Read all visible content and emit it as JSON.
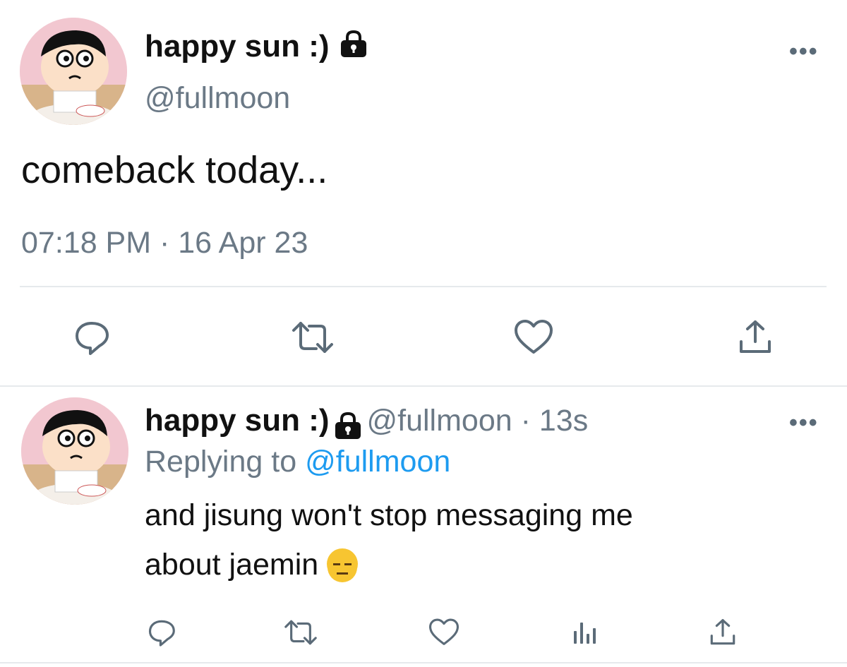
{
  "main_tweet": {
    "display_name": "happy sun :)",
    "handle": "@fullmoon",
    "text": "comeback today...",
    "timestamp": "07:18 PM · 16 Apr 23",
    "more_label": "•••",
    "avatar_icon": "cartoon-avatar",
    "lock_icon": "lock-icon"
  },
  "actions": {
    "reply_icon": "reply-icon",
    "retweet_icon": "retweet-icon",
    "like_icon": "heart-icon",
    "share_icon": "share-icon",
    "views_icon": "views-icon"
  },
  "reply_tweet": {
    "display_name": "happy sun :)",
    "handle_time": "@fullmoon · 13s",
    "replying_prefix": "Replying to",
    "replying_to": "@fullmoon",
    "text_line1": "and jisung won't stop messaging me",
    "text_line2": "about jaemin",
    "emoji": "😑",
    "more_label": "•••"
  },
  "colors": {
    "link": "#1d9bf0",
    "muted": "#6b7986",
    "text": "#111111",
    "divider": "#e6e9ec"
  }
}
